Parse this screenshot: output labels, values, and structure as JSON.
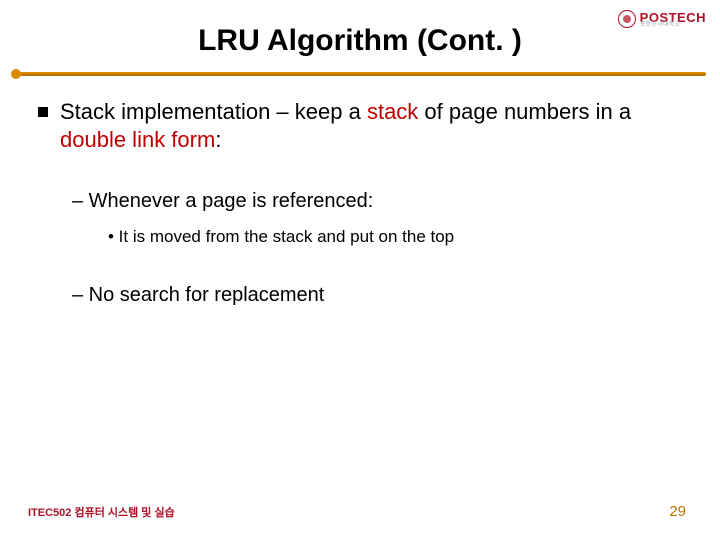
{
  "logo": {
    "name": "POSTECH",
    "sub": "포항공과대학교"
  },
  "title": "LRU Algorithm (Cont. )",
  "bullet1": {
    "pre": "Stack implementation – keep a ",
    "hl1": "stack",
    "mid": " of page numbers in a ",
    "hl2": "double link form",
    "post": ":"
  },
  "sub1": "– Whenever a page is referenced:",
  "sub1_detail": "• It is moved from the stack and put on the top",
  "sub2": "– No search for replacement",
  "footer": {
    "course": "ITEC502 컴퓨터 시스템 및 실습",
    "page": "29"
  }
}
